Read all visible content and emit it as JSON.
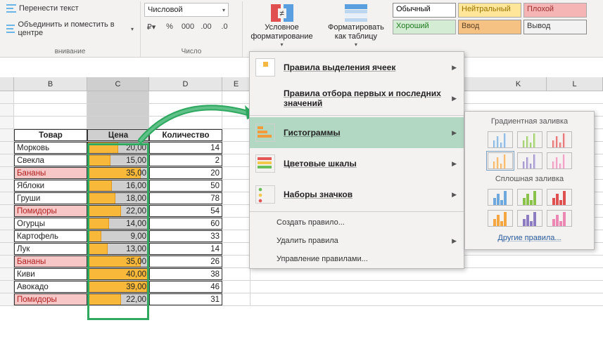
{
  "ribbon": {
    "wrap_text": "Перенести текст",
    "merge_center": "Объединить и поместить в центре",
    "alignment_label": "внивание",
    "number_format": "Числовой",
    "number_group_label": "Число",
    "cond_fmt": "Условное форматирование",
    "format_table": "Форматировать как таблицу",
    "styles": [
      {
        "label": "Обычный",
        "bg": "#ffffff",
        "color": "#000",
        "border": "#888"
      },
      {
        "label": "Нейтральный",
        "bg": "#ffe699",
        "color": "#997300",
        "border": "#aaa"
      },
      {
        "label": "Плохой",
        "bg": "#f5b5b5",
        "color": "#9c2e2e",
        "border": "#aaa"
      },
      {
        "label": "Хороший",
        "bg": "#d3ecd3",
        "color": "#1f7a1f",
        "border": "#aaa"
      },
      {
        "label": "Ввод",
        "bg": "#f6c284",
        "color": "#5f4425",
        "border": "#9a9a9a"
      },
      {
        "label": "Вывод",
        "bg": "#f2f2f2",
        "color": "#333",
        "border": "#888"
      }
    ]
  },
  "columns": [
    "B",
    "C",
    "D",
    "E",
    "K",
    "L"
  ],
  "table": {
    "headers": {
      "name": "Товар",
      "price": "Цена",
      "qty": "Количество"
    },
    "max_price": 40,
    "rows": [
      {
        "name": "Морковь",
        "price": "20,00",
        "qty": "14",
        "bar": 20,
        "red": false
      },
      {
        "name": "Свекла",
        "price": "15,00",
        "qty": "2",
        "bar": 15,
        "red": false
      },
      {
        "name": "Бананы",
        "price": "35,00",
        "qty": "20",
        "bar": 35,
        "red": true
      },
      {
        "name": "Яблоки",
        "price": "16,00",
        "qty": "50",
        "bar": 16,
        "red": false
      },
      {
        "name": "Груши",
        "price": "18,00",
        "qty": "78",
        "bar": 18,
        "red": false
      },
      {
        "name": "Помидоры",
        "price": "22,00",
        "qty": "54",
        "bar": 22,
        "red": true
      },
      {
        "name": "Огурцы",
        "price": "14,00",
        "qty": "60",
        "bar": 14,
        "red": false
      },
      {
        "name": "Картофель",
        "price": "9,00",
        "qty": "33",
        "bar": 9,
        "red": false
      },
      {
        "name": "Лук",
        "price": "13,00",
        "qty": "14",
        "bar": 13,
        "red": false
      },
      {
        "name": "Бананы",
        "price": "35,00",
        "qty": "26",
        "bar": 35,
        "red": true
      },
      {
        "name": "Киви",
        "price": "40,00",
        "qty": "38",
        "bar": 40,
        "red": false
      },
      {
        "name": "Авокадо",
        "price": "39,00",
        "qty": "46",
        "bar": 39,
        "red": false
      },
      {
        "name": "Помидоры",
        "price": "22,00",
        "qty": "31",
        "bar": 22,
        "red": true
      }
    ]
  },
  "dropdown": {
    "items": [
      {
        "label": "Правила выделения ячеек",
        "icon": "highlight"
      },
      {
        "label": "Правила отбора первых и последних значений",
        "icon": "rank"
      },
      {
        "label": "Гистограммы",
        "icon": "databar",
        "hover": true
      },
      {
        "label": "Цветовые шкалы",
        "icon": "colorscale"
      },
      {
        "label": "Наборы значков",
        "icon": "iconset"
      }
    ],
    "actions": [
      "Создать правило...",
      "Удалить правила",
      "Управление правилами..."
    ]
  },
  "submenu": {
    "gradient_label": "Градиентная заливка",
    "solid_label": "Сплошная заливка",
    "other_rules": "Другие правила...",
    "gradient_colors": [
      "#6fa8dc",
      "#8bc34a",
      "#e05050",
      "#f6a641",
      "#8e7cc3",
      "#ec87b4"
    ],
    "solid_colors": [
      "#6fa8dc",
      "#8bc34a",
      "#e05050",
      "#f6a641",
      "#8e7cc3",
      "#ec87b4"
    ],
    "selected_index": 3
  }
}
